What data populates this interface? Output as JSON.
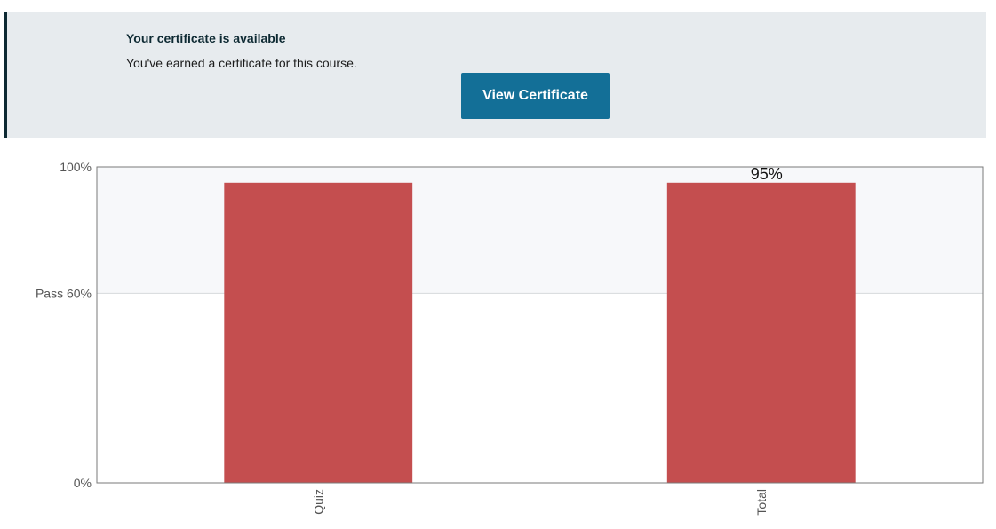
{
  "banner": {
    "title": "Your certificate is available",
    "message": "You've earned a certificate for this course.",
    "button_label": "View Certificate"
  },
  "colors": {
    "banner_bg": "#e7ebee",
    "banner_accent": "#0e2a33",
    "button_bg": "#136f97",
    "bar": "#c44e4f",
    "pass_zone": "#f7f8fa"
  },
  "chart_data": {
    "type": "bar",
    "categories": [
      "Quiz",
      "Total"
    ],
    "values": [
      95,
      95
    ],
    "ylim": [
      0,
      100
    ],
    "pass_threshold": 60,
    "y_ticks": [
      {
        "value": 100,
        "label": "100%"
      },
      {
        "value": 60,
        "label": "Pass 60%"
      },
      {
        "value": 0,
        "label": "0%"
      }
    ],
    "data_labels": [
      {
        "category": "Total",
        "text": "95%"
      }
    ],
    "grid": false,
    "xlabel": "",
    "ylabel": ""
  }
}
